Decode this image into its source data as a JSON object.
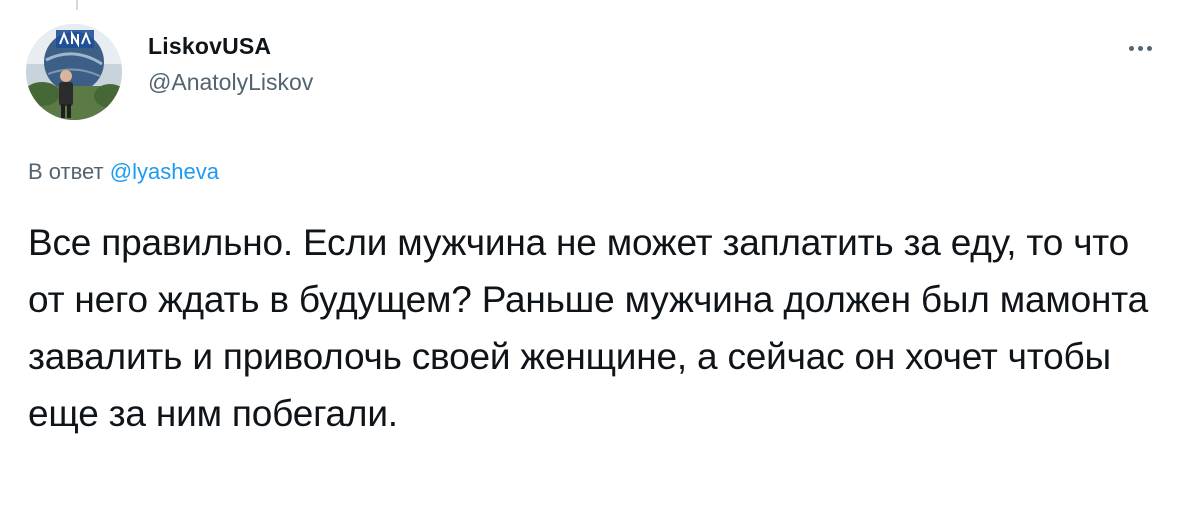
{
  "author": {
    "display_name": "LiskovUSA",
    "handle": "@AnatolyLiskov",
    "avatar_logo_text": "NASA"
  },
  "menu": {
    "icon": "more-horizontal-icon"
  },
  "reply": {
    "prefix": "В ответ",
    "mention": "@lyasheva"
  },
  "tweet": {
    "text": "Все правильно. Если мужчина не может заплатить за еду, то что от него ждать в будущем? Раньше мужчина должен был мамонта завалить и приволочь своей женщине, а сейчас он хочет чтобы еще за ним побегали."
  },
  "colors": {
    "text_primary": "#0f1419",
    "text_secondary": "#536471",
    "link": "#1d9bf0",
    "thread_line": "#cfd9de"
  }
}
